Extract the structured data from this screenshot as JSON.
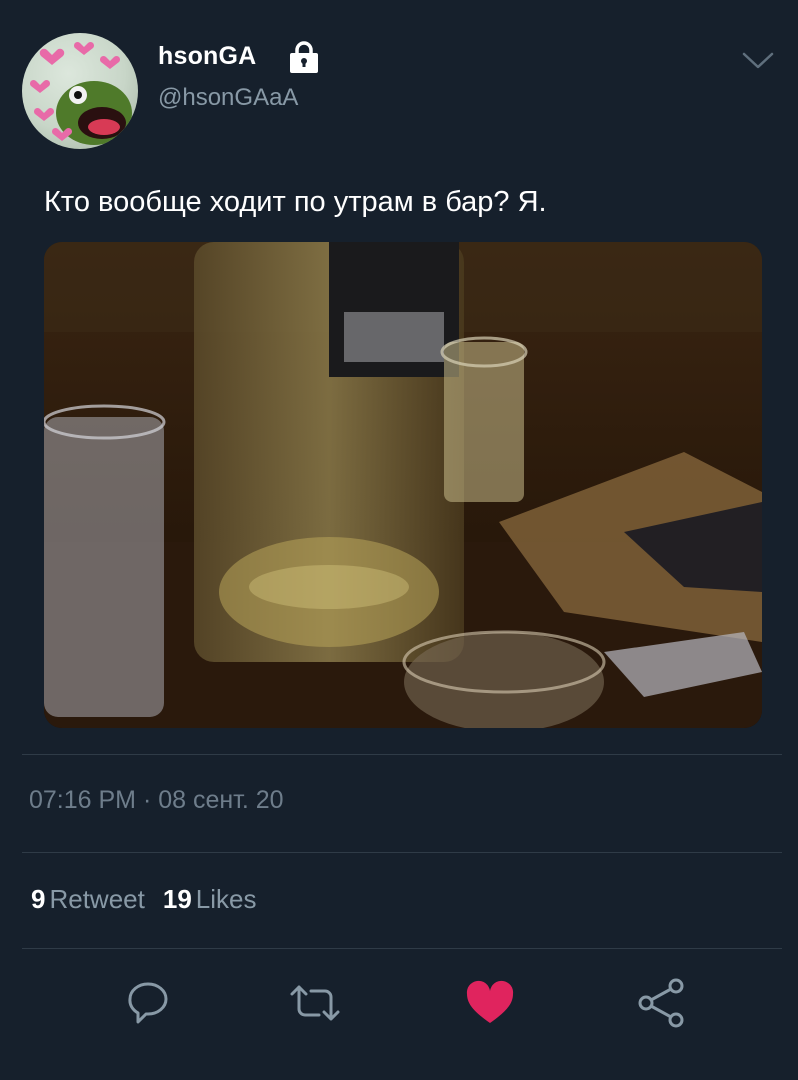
{
  "user": {
    "display_name": "hsonGA",
    "handle": "@hsonGAaA",
    "avatar_icon": "kermit-frog-with-hearts-avatar",
    "protected_icon": "lock-icon"
  },
  "tweet": {
    "text": "Кто вообще ходит по утрам в бар? Я.",
    "timestamp": "07:16 PM · 08 сент. 20"
  },
  "stats": {
    "retweet_count": "9",
    "retweet_label": "Retweet",
    "likes_count": "19",
    "likes_label": "Likes"
  },
  "actions": {
    "reply_icon": "reply-icon",
    "retweet_icon": "retweet-icon",
    "like_icon": "heart-icon",
    "share_icon": "share-icon"
  },
  "colors": {
    "background": "#16202c",
    "secondary_text": "#8899a6",
    "divider": "#2f3b47",
    "like_active": "#e0245e"
  }
}
